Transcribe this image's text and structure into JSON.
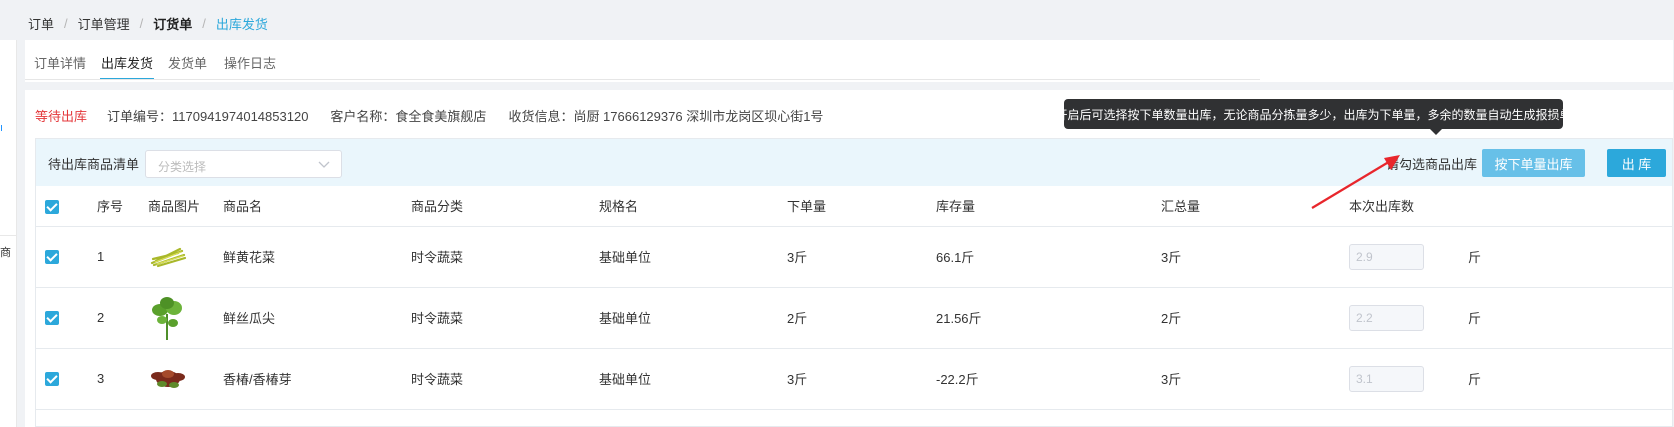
{
  "breadcrumb": {
    "items": [
      "订单",
      "订单管理",
      "订货单",
      "出库发货"
    ],
    "separator": "/"
  },
  "tabs": [
    "订单详情",
    "出库发货",
    "发货单",
    "操作日志"
  ],
  "order_info": {
    "status": "等待出库",
    "order_no": "订单编号：1170941974014853120",
    "customer": "客户名称：食全食美旗舰店",
    "receiver": "收货信息：尚厨 17666129376 深圳市龙岗区坝心街1号"
  },
  "panel": {
    "title": "待出库商品清单",
    "category_placeholder": "分类选择",
    "hint": "请勾选商品出库",
    "btn_by_order_qty": "按下单量出库",
    "btn_outbound": "出 库"
  },
  "tooltip": "开启后可选择按下单数量出库，无论商品分拣量多少，出库为下单量，多余的数量自动生成报损单",
  "table": {
    "headers": [
      "序号",
      "商品图片",
      "商品名",
      "商品分类",
      "规格名",
      "下单量",
      "库存量",
      "汇总量",
      "本次出库数"
    ],
    "rows": [
      {
        "no": "1",
        "name": "鲜黄花菜",
        "category": "时令蔬菜",
        "spec": "基础单位",
        "order_qty": "3斤",
        "stock": "66.1斤",
        "total": "3斤",
        "outbound": "2.9",
        "unit": "斤",
        "checked": true
      },
      {
        "no": "2",
        "name": "鲜丝瓜尖",
        "category": "时令蔬菜",
        "spec": "基础单位",
        "order_qty": "2斤",
        "stock": "21.56斤",
        "total": "2斤",
        "outbound": "2.2",
        "unit": "斤",
        "checked": true
      },
      {
        "no": "3",
        "name": "香椿/香椿芽",
        "category": "时令蔬菜",
        "spec": "基础单位",
        "order_qty": "3斤",
        "stock": "-22.2斤",
        "total": "3斤",
        "outbound": "3.1",
        "unit": "斤",
        "checked": true
      }
    ]
  },
  "colors": {
    "accent": "#2ca8db",
    "status_red": "#e4393c",
    "tooltip_bg": "#303133",
    "arrow": "#e8262c"
  }
}
